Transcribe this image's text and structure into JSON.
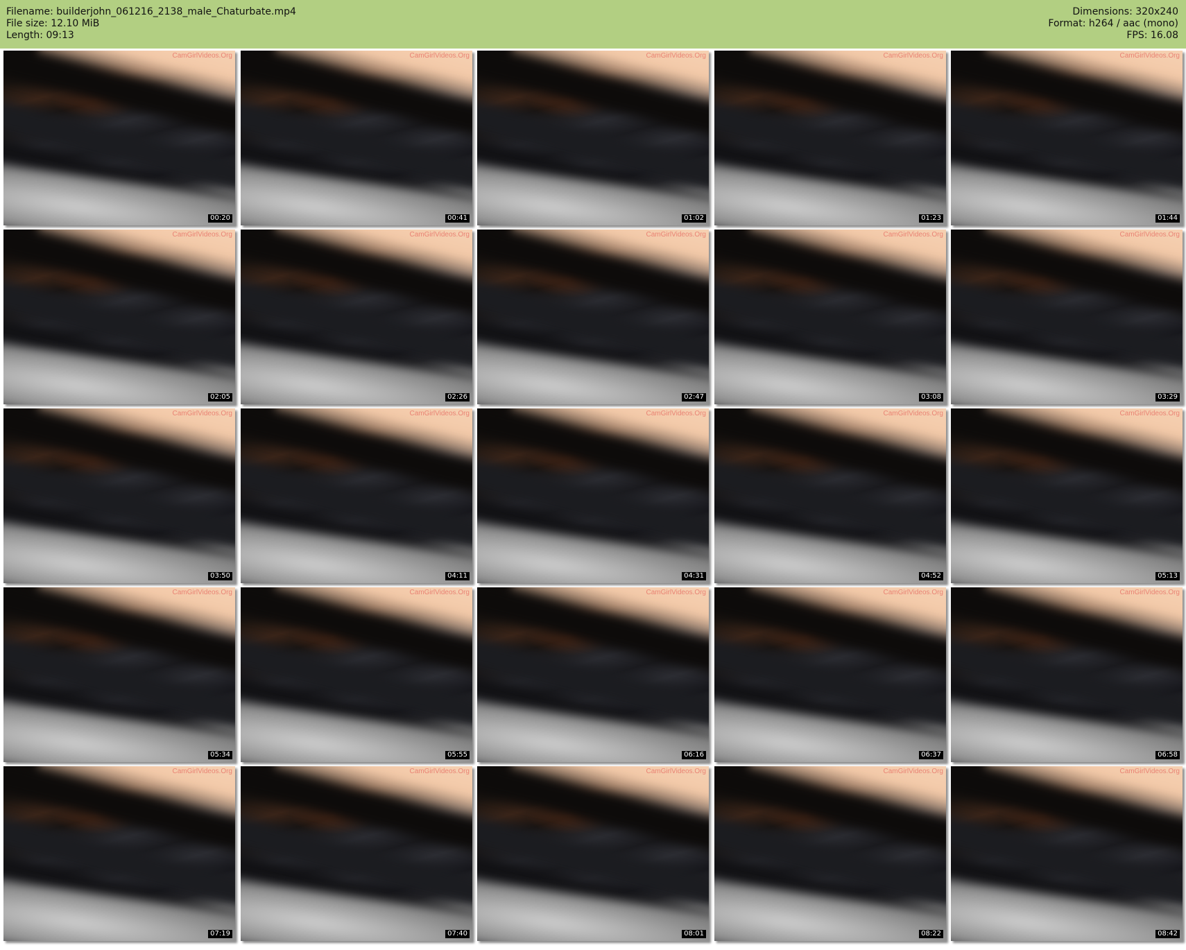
{
  "header": {
    "filename": "Filename: builderjohn_061216_2138_male_Chaturbate.mp4",
    "filesize": "File size: 12.10 MiB",
    "length": "Length: 09:13",
    "dimensions": "Dimensions: 320x240",
    "format": "Format: h264 / aac (mono)",
    "fps": "FPS: 16.08",
    "background_color": "#b2cf82"
  },
  "watermark": "CamGirlVideos.Org",
  "thumbnails": [
    {
      "timestamp": "00:20"
    },
    {
      "timestamp": "00:41"
    },
    {
      "timestamp": "01:02"
    },
    {
      "timestamp": "01:23"
    },
    {
      "timestamp": "01:44"
    },
    {
      "timestamp": "02:05"
    },
    {
      "timestamp": "02:26"
    },
    {
      "timestamp": "02:47"
    },
    {
      "timestamp": "03:08"
    },
    {
      "timestamp": "03:29"
    },
    {
      "timestamp": "03:50"
    },
    {
      "timestamp": "04:11"
    },
    {
      "timestamp": "04:31"
    },
    {
      "timestamp": "04:52"
    },
    {
      "timestamp": "05:13"
    },
    {
      "timestamp": "05:34"
    },
    {
      "timestamp": "05:55"
    },
    {
      "timestamp": "06:16"
    },
    {
      "timestamp": "06:37"
    },
    {
      "timestamp": "06:58"
    },
    {
      "timestamp": "07:19"
    },
    {
      "timestamp": "07:40"
    },
    {
      "timestamp": "08:01"
    },
    {
      "timestamp": "08:22"
    },
    {
      "timestamp": "08:42"
    }
  ]
}
